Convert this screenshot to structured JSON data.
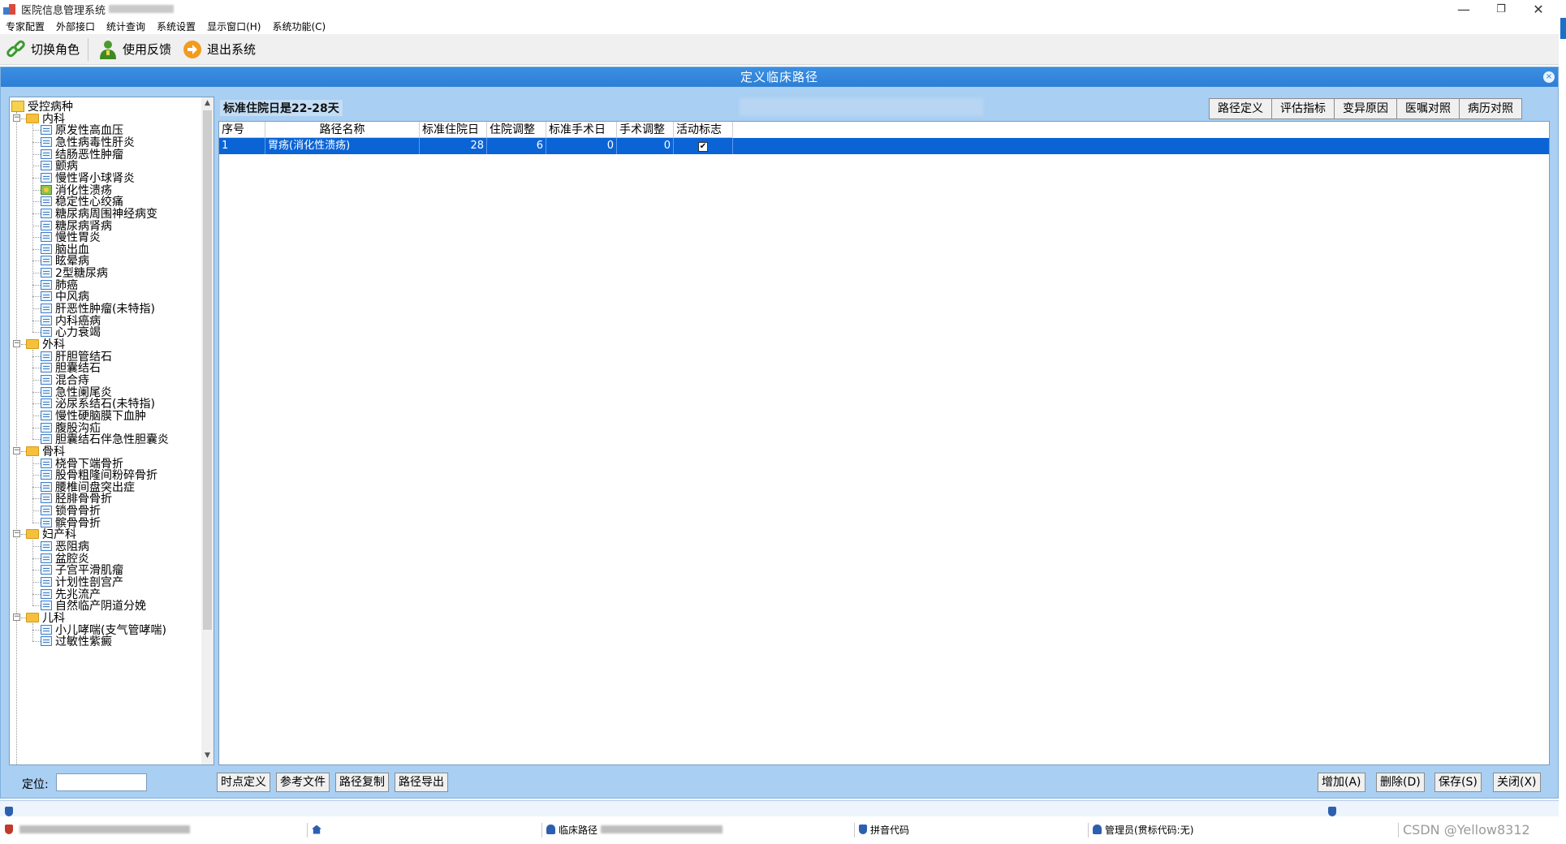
{
  "window": {
    "title": "医院信息管理系统",
    "min_glyph": "—",
    "max_glyph": "❐",
    "close_glyph": "✕"
  },
  "menu": [
    "专家配置",
    "外部接口",
    "统计查询",
    "系统设置",
    "显示窗口(H)",
    "系统功能(C)"
  ],
  "toolbar": {
    "switch_role": "切换角色",
    "feedback": "使用反馈",
    "exit": "退出系统",
    "icons": [
      "link-icon",
      "user-feedback-icon",
      "exit-arrow-icon"
    ]
  },
  "frame": {
    "title": "定义临床路径",
    "close_glyph": "×"
  },
  "tree": {
    "root": "受控病种",
    "departments": [
      {
        "name": "内科",
        "items": [
          "原发性高血压",
          "急性病毒性肝炎",
          "结肠恶性肿瘤",
          "颤病",
          "慢性肾小球肾炎",
          "消化性溃疡",
          "稳定性心绞痛",
          "糖尿病周围神经病变",
          "糖尿病肾病",
          "慢性胃炎",
          "脑出血",
          "眩晕病",
          "2型糖尿病",
          "肺癌",
          "中风病",
          "肝恶性肿瘤(未特指)",
          "内科癌病",
          "心力衰竭"
        ]
      },
      {
        "name": "外科",
        "items": [
          "肝胆管结石",
          "胆囊结石",
          "混合痔",
          "急性阑尾炎",
          "泌尿系结石(未特指)",
          "慢性硬脑膜下血肿",
          "腹股沟疝",
          "胆囊结石伴急性胆囊炎"
        ]
      },
      {
        "name": "骨科",
        "items": [
          "桡骨下端骨折",
          "股骨粗隆间粉碎骨折",
          "腰椎间盘突出症",
          "胫腓骨骨折",
          "锁骨骨折",
          "髌骨骨折"
        ]
      },
      {
        "name": "妇产科",
        "items": [
          "恶阻病",
          "盆腔炎",
          "子宫平滑肌瘤",
          "计划性剖宫产",
          "先兆流产",
          "自然临产阴道分娩"
        ]
      },
      {
        "name": "儿科",
        "items": [
          "小儿哮喘(支气管哮喘)",
          "过敏性紫癜"
        ]
      }
    ],
    "selected": "消化性溃疡"
  },
  "info": {
    "text": "标准住院日是22-28天"
  },
  "tabs": [
    "路径定义",
    "评估指标",
    "变异原因",
    "医嘱对照",
    "病历对照"
  ],
  "grid": {
    "columns": [
      "序号",
      "路径名称",
      "标准住院日",
      "住院调整",
      "标准手术日",
      "手术调整",
      "活动标志"
    ],
    "rows": [
      {
        "seq": "1",
        "name": "胃疡(消化性溃疡)",
        "std_days": "28",
        "adjust": "6",
        "op_day": "0",
        "op_adjust": "0",
        "active": true,
        "check_glyph": "✔"
      }
    ]
  },
  "bottom": {
    "locate_label": "定位:",
    "locate_value": "",
    "left_buttons": [
      "时点定义",
      "参考文件",
      "路径复制",
      "路径导出"
    ],
    "right_buttons": [
      "增加(A)",
      "删除(D)",
      "保存(S)",
      "关闭(X)"
    ]
  },
  "status": {
    "clinical_path": "临床路径",
    "pinyin": "拼音代码",
    "admin": "管理员(贯标代码:无)",
    "watermark": "CSDN @Yellow8312"
  },
  "colors": {
    "accent": "#2d7fd6",
    "selection": "#0a64d6",
    "panel": "#a9cff2"
  }
}
